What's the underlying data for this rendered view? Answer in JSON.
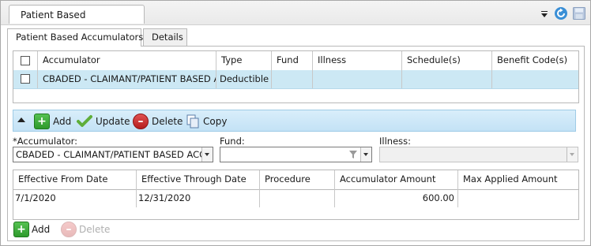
{
  "window": {
    "tab_title": "Patient Based Accumulators",
    "icons": [
      "dropdown-icon",
      "refresh-icon",
      "save-icon"
    ]
  },
  "subtabs": [
    {
      "label": "Patient Based Accumulators",
      "active": true
    },
    {
      "label": "Details",
      "active": false
    }
  ],
  "accumulator_grid": {
    "headers": [
      "Accumulator",
      "Type",
      "Fund",
      "Illness",
      "Schedule(s)",
      "Benefit Code(s)"
    ],
    "rows": [
      {
        "accumulator": "CBADED - CLAIMANT/PATIENT BASED AC",
        "type": "Deductible",
        "fund": "",
        "illness": "",
        "schedules": "",
        "benefit_codes": "",
        "selected": true
      }
    ]
  },
  "toolbar": {
    "add_label": "Add",
    "update_label": "Update",
    "delete_label": "Delete",
    "copy_label": "Copy"
  },
  "form": {
    "accumulator_label": "*Accumulator:",
    "accumulator_value": "CBADED - CLAIMANT/PATIENT BASED ACCU",
    "fund_label": "Fund:",
    "fund_value": "",
    "illness_label": "Illness:",
    "illness_value": ""
  },
  "dates_grid": {
    "headers": [
      "Effective From Date",
      "Effective Through Date",
      "Procedure",
      "Accumulator Amount",
      "Max Applied Amount"
    ],
    "rows": [
      {
        "from": "7/1/2020",
        "through": "12/31/2020",
        "procedure": "",
        "amount": "600.00",
        "max_applied": ""
      }
    ]
  },
  "bottom": {
    "add_label": "Add",
    "delete_label": "Delete"
  },
  "colors": {
    "selection": "#cce8f4",
    "toolbar": "#c3e2f6",
    "add_green": "#2e9a2c",
    "delete_red": "#b51d1d"
  }
}
